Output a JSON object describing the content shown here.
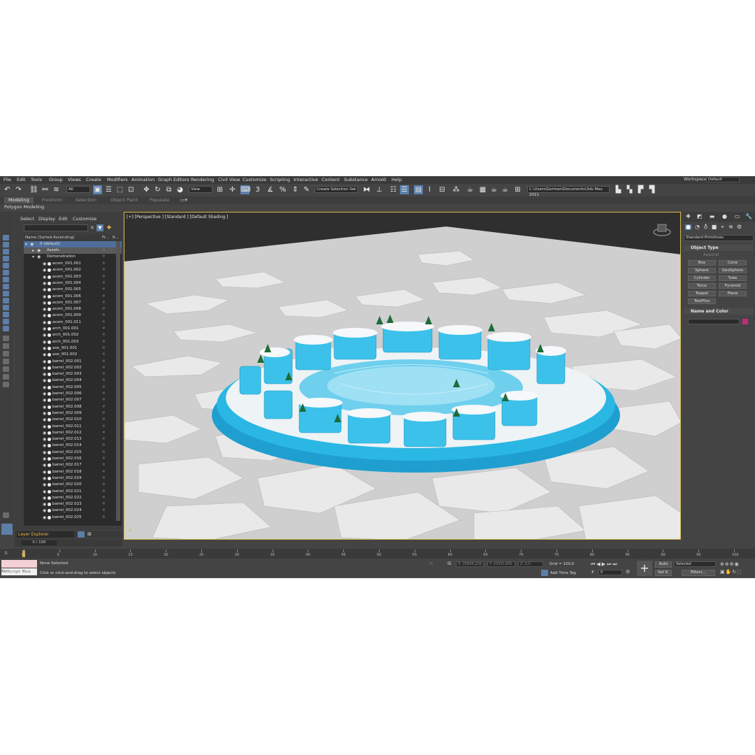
{
  "menu": [
    "File",
    "Edit",
    "Tools",
    "Group",
    "Views",
    "Create",
    "Modifiers",
    "Animation",
    "Graph Editors",
    "Rendering",
    "Civil View",
    "Customize",
    "Scripting",
    "Interactive",
    "Content",
    "Substance",
    "Arnold",
    "Help"
  ],
  "workspace": {
    "label": "Workspaces:",
    "value": "Default"
  },
  "toolbar": {
    "filter": "All",
    "coord": "View",
    "selection_set": "Create Selection Set",
    "path": "C:\\Users\\German\\Documents\\3ds Max 2021"
  },
  "ribbon": {
    "tabs": [
      "Modeling",
      "Freeform",
      "Selection",
      "Object Paint",
      "Populate"
    ],
    "sub": "Polygon Modeling"
  },
  "explorer": {
    "menu": [
      "Select",
      "Display",
      "Edit",
      "Customize"
    ],
    "columns": {
      "name": "Name (Sorted Ascending)",
      "frozen": "Fr...",
      "render": "R..."
    },
    "root": "0 (default)",
    "assets": "Assets",
    "demo": "Demonstration",
    "items": [
      "acorn_001.001",
      "acorn_001.002",
      "acorn_001.003",
      "acorn_001.004",
      "acorn_001.005",
      "acorn_001.006",
      "acorn_001.007",
      "acorn_001.008",
      "acorn_001.009",
      "acorn_001.011",
      "arch_001.001",
      "arch_001.002",
      "arch_001.003",
      "axe_001.001",
      "axe_001.002",
      "barrel_002.001",
      "barrel_002.002",
      "barrel_002.003",
      "barrel_002.004",
      "barrel_002.005",
      "barrel_002.006",
      "barrel_002.007",
      "barrel_002.008",
      "barrel_002.009",
      "barrel_002.010",
      "barrel_002.011",
      "barrel_002.012",
      "barrel_002.013",
      "barrel_002.014",
      "barrel_002.015",
      "barrel_002.016",
      "barrel_002.017",
      "barrel_002.018",
      "barrel_002.019",
      "barrel_002.020",
      "barrel_002.021",
      "barrel_002.022",
      "barrel_002.023",
      "barrel_002.024",
      "barrel_002.025"
    ],
    "layer_label": "Layer Explorer",
    "frame_counter": "0 / 100"
  },
  "viewport": {
    "label": "[+] [Perspective ] [Standard ] [Default Shading ]"
  },
  "command_panel": {
    "category": "Standard Primitives",
    "object_type": "Object Type",
    "autogrid": "AutoGrid",
    "primitives": [
      "Box",
      "Cone",
      "Sphere",
      "GeoSphere",
      "Cylinder",
      "Tube",
      "Torus",
      "Pyramid",
      "Teapot",
      "Plane",
      "TextPlus"
    ],
    "name_color": "Name and Color",
    "color": "#c02c7e"
  },
  "timeline": {
    "ticks": [
      "0",
      "5",
      "10",
      "15",
      "20",
      "25",
      "30",
      "35",
      "40",
      "45",
      "50",
      "55",
      "60",
      "65",
      "70",
      "75",
      "80",
      "85",
      "90",
      "95",
      "100"
    ]
  },
  "status": {
    "maxscript": "MAXScript Mini",
    "selection": "None Selected",
    "prompt": "Click or click-and-drag to select objects",
    "x": "X: 25894,226",
    "y": "Y: 10431,842",
    "z": "Z: 0,0",
    "grid": "Grid = 100,0",
    "add_time_tag": "Add Time Tag",
    "auto": "Auto",
    "selected": "Selected",
    "setk": "Set K.",
    "filters": "Filters...",
    "frame": "0"
  }
}
